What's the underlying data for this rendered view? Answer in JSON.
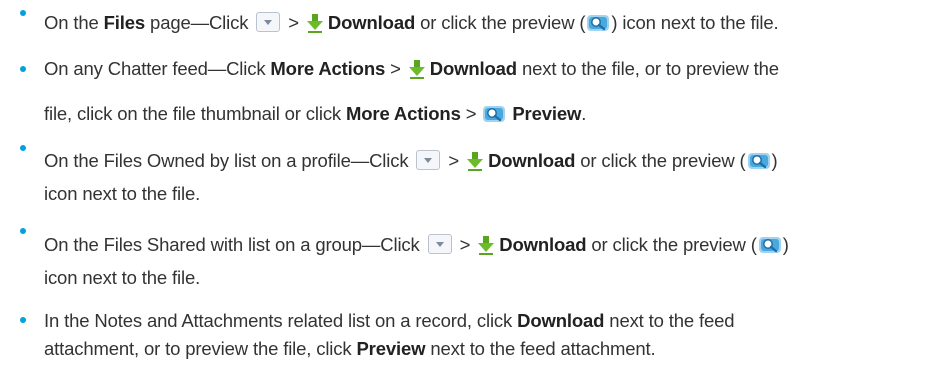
{
  "items": [
    {
      "line1": {
        "t1": "On the ",
        "b1": "Files",
        "t2": " page—Click ",
        "t3": " > ",
        "b2": "Download",
        "t4": " or click the preview (",
        "t5": ") icon next to the file."
      }
    },
    {
      "line1": {
        "t1": "On any Chatter feed—Click ",
        "b1": "More Actions",
        "t2": " > ",
        "b2": "Download",
        "t3": " next to the file, or to preview the"
      },
      "line2": {
        "t1": "file, click on the file thumbnail or click ",
        "b1": "More Actions",
        "t2": " > ",
        "b2": "Preview",
        "t3": "."
      }
    },
    {
      "line1": {
        "t1": "On the Files Owned by list on a profile—Click ",
        "t2": " > ",
        "b1": "Download",
        "t3": " or click the preview ("
      },
      "line2": {
        "t1": "icon next to the file."
      },
      "close": ")"
    },
    {
      "line1": {
        "t1": "On the Files Shared with list on a group—Click ",
        "t2": " > ",
        "b1": "Download",
        "t3": " or click the preview ("
      },
      "line2": {
        "t1": "icon next to the file."
      },
      "close": ")"
    },
    {
      "line1": {
        "t1": "In the Notes and Attachments related list on a record, click ",
        "b1": "Download",
        "t2": " next to the feed"
      },
      "line2": {
        "t1": "attachment, or to preview the file, click ",
        "b1": "Preview",
        "t2": " next to the feed attachment."
      }
    }
  ],
  "icons": {
    "bullet_color": "#00a1e0",
    "download_icon": "download-arrow-icon",
    "preview_icon": "preview-magnifier-icon",
    "dropdown_icon": "dropdown-menu-icon"
  }
}
